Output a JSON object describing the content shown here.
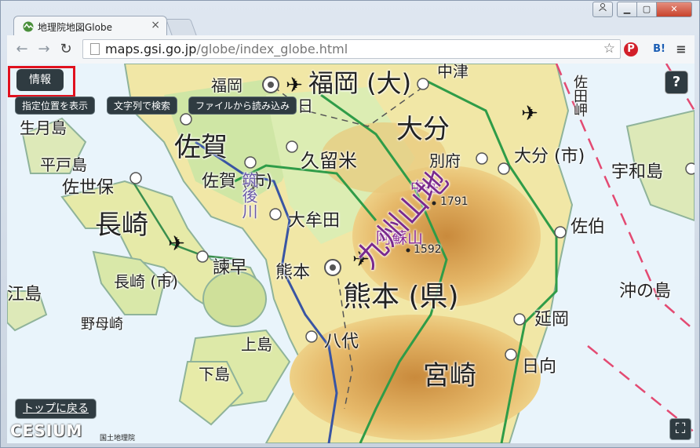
{
  "browser": {
    "tab_title": "地理院地図Globe",
    "tab_close": "×",
    "url_domain": "maps.gsi.go.jp",
    "url_path": "/globe/index_globe.html",
    "bookmark_icon": "star-icon",
    "ext_red_label": "P",
    "ext_bl_label": "B!",
    "menu_icon": "≡",
    "window_buttons": {
      "minimize": "▁",
      "maximize": "▢",
      "close": "✕",
      "user": "👤"
    }
  },
  "nav": {
    "back": "←",
    "forward": "→",
    "reload": "↻"
  },
  "overlay": {
    "info_label": "情報",
    "show_location_label": "指定位置を表示",
    "text_search_label": "文字列で検索",
    "load_file_label": "ファイルから読み込み",
    "help_label": "?",
    "top_label": "トップに戻る",
    "cesium_logo": "CESIUM",
    "attribution": "国土地理院",
    "fullscreen_label": "⛶"
  },
  "map": {
    "places": [
      {
        "name": "福岡"
      },
      {
        "name": "福岡 (大)"
      },
      {
        "name": "中津"
      },
      {
        "name": "春日"
      },
      {
        "name": "生月島"
      },
      {
        "name": "佐賀"
      },
      {
        "name": "大分"
      },
      {
        "name": "佐田岬"
      },
      {
        "name": "平戸島"
      },
      {
        "name": "久留米"
      },
      {
        "name": "別府"
      },
      {
        "name": "大分 (市)"
      },
      {
        "name": "宇和島"
      },
      {
        "name": "佐世保"
      },
      {
        "name": "佐賀 (市)"
      },
      {
        "name": "中岳"
      },
      {
        "name": "1791"
      },
      {
        "name": "長崎"
      },
      {
        "name": "筑後川"
      },
      {
        "name": "大牟田"
      },
      {
        "name": "阿蘇山"
      },
      {
        "name": "佐伯"
      },
      {
        "name": "1592"
      },
      {
        "name": "諫早"
      },
      {
        "name": "長崎 (市)"
      },
      {
        "name": "熊本"
      },
      {
        "name": "江島"
      },
      {
        "name": "熊本 (県)"
      },
      {
        "name": "沖の島"
      },
      {
        "name": "九州山地"
      },
      {
        "name": "野母崎"
      },
      {
        "name": "延岡"
      },
      {
        "name": "上島"
      },
      {
        "name": "八代"
      },
      {
        "name": "下島"
      },
      {
        "name": "宮崎"
      },
      {
        "name": "日向"
      }
    ]
  }
}
